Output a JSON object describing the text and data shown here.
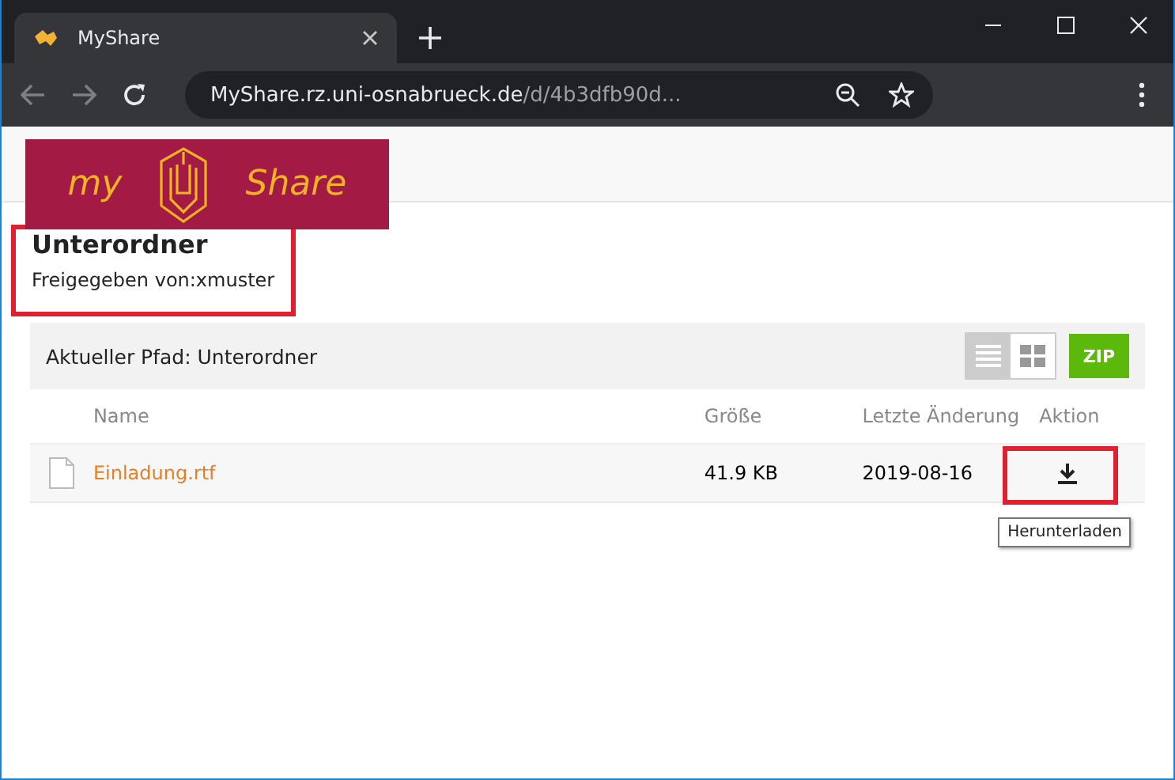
{
  "browser": {
    "tab": {
      "title": "MyShare",
      "selected": true
    },
    "url": {
      "host": "MyShare.rz.uni-osnabrueck.de",
      "path": "/d/4b3dfb90d..."
    }
  },
  "logo": {
    "left": "my",
    "right": "Share"
  },
  "folder": {
    "title": "Unterordner",
    "shared_by": "Freigegeben von:xmuster"
  },
  "path_bar": {
    "label": "Aktueller Pfad: Unterordner",
    "views": [
      {
        "kind": "list",
        "selected": true
      },
      {
        "kind": "grid",
        "selected": false
      }
    ],
    "zip_button": "ZIP"
  },
  "table": {
    "columns": [
      "Name",
      "Größe",
      "Letzte Änderung",
      "Aktion"
    ],
    "rows": [
      {
        "name": "Einladung.rtf",
        "size": "41.9 KB",
        "modified": "2019-08-16",
        "action_tooltip": "Herunterladen"
      }
    ]
  },
  "annotations": [
    {
      "kind": "highlight"
    },
    {
      "kind": "highlight"
    }
  ]
}
